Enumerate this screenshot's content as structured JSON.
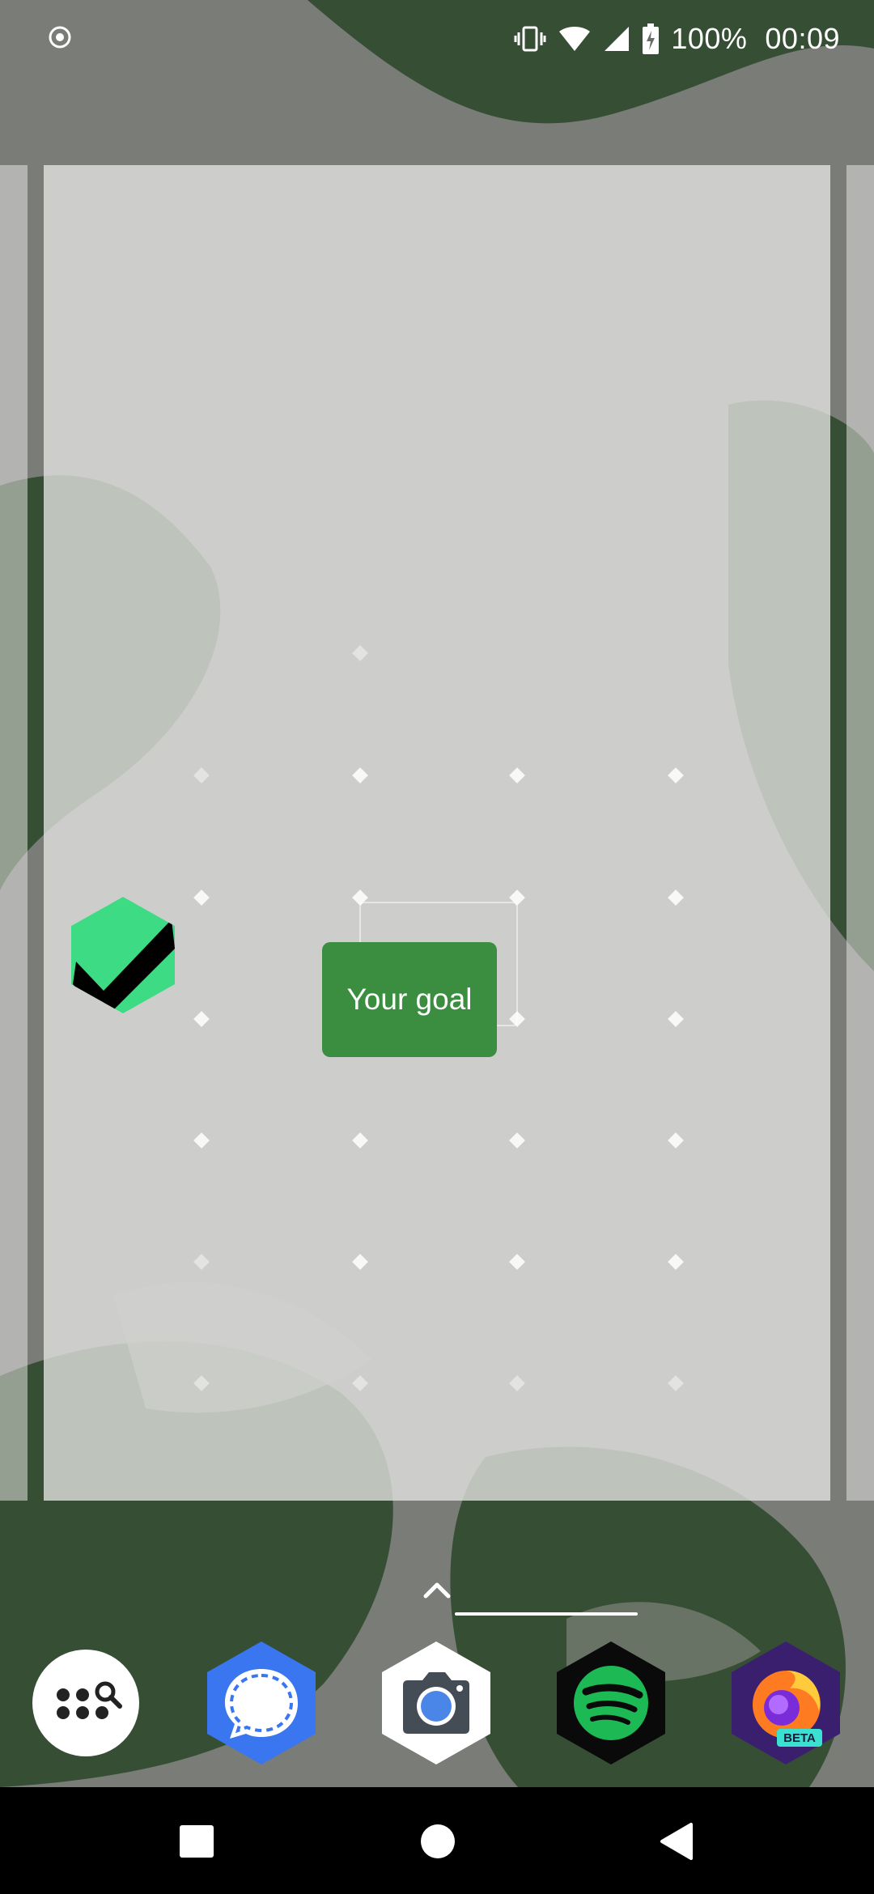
{
  "status_bar": {
    "battery_text": "100%",
    "time": "00:09",
    "icons": [
      "screen-record-icon",
      "vibrate-icon",
      "wifi-icon",
      "signal-icon",
      "battery-charging-icon"
    ]
  },
  "home_screen": {
    "widget": {
      "label": "Your goal",
      "color": "#3b8e3f"
    },
    "habit_app_icon": {
      "icon": "check-hexagon-icon",
      "color": "#3ddc84"
    }
  },
  "dock": {
    "apps": [
      {
        "name": "app-drawer-search",
        "icon": "grid-search-icon"
      },
      {
        "name": "Signal",
        "icon": "signal-chat-icon",
        "color": "#3a76f0"
      },
      {
        "name": "Camera",
        "icon": "camera-icon"
      },
      {
        "name": "Spotify",
        "icon": "spotify-icon",
        "color": "#1db954"
      },
      {
        "name": "Firefox Beta",
        "icon": "firefox-beta-icon",
        "badge": "BETA"
      }
    ]
  },
  "navigation": {
    "buttons": [
      "recent-apps",
      "home",
      "back"
    ]
  }
}
